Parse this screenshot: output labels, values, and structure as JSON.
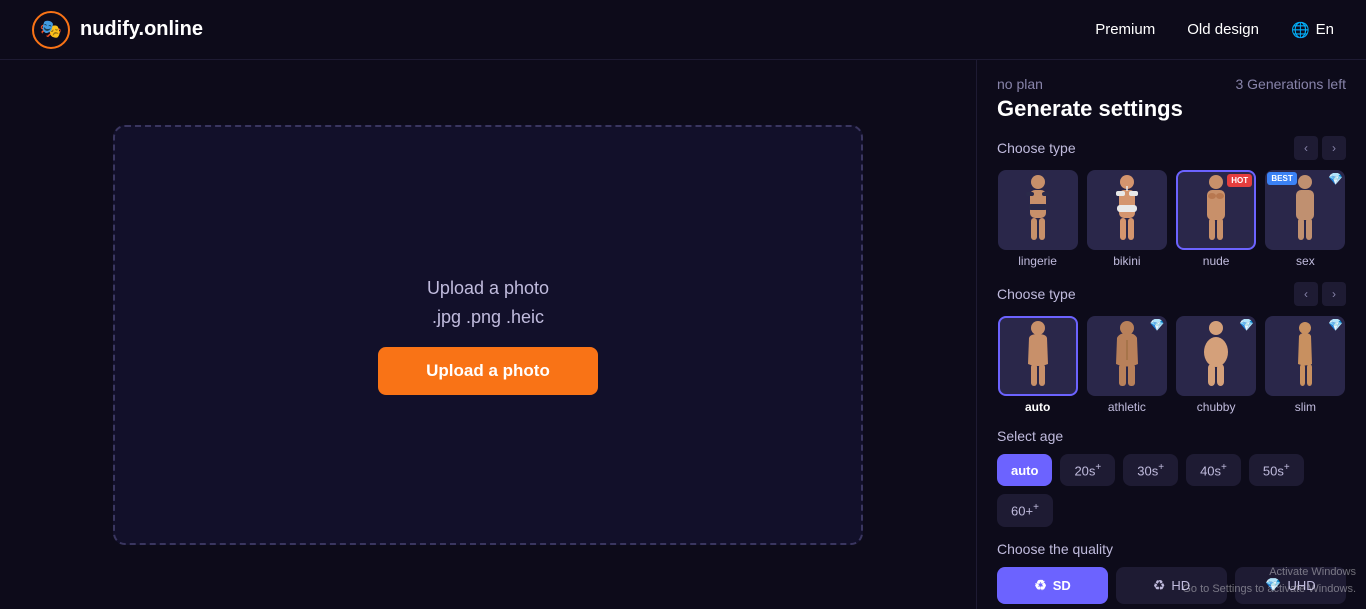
{
  "header": {
    "logo_icon": "🎭",
    "logo_text": "nudify.online",
    "nav": {
      "premium": "Premium",
      "old_design": "Old design",
      "language": "En"
    }
  },
  "upload": {
    "instruction_line1": "Upload a photo",
    "instruction_line2": ".jpg .png .heic",
    "button_label": "Upload a photo"
  },
  "settings": {
    "plan_label": "no plan",
    "generations_left": "3 Generations left",
    "title": "Generate settings",
    "choose_type_label": "Choose type",
    "type_options": [
      {
        "id": "lingerie",
        "label": "lingerie",
        "badge": null
      },
      {
        "id": "bikini",
        "label": "bikini",
        "badge": null
      },
      {
        "id": "nude",
        "label": "nude",
        "badge": "HOT"
      },
      {
        "id": "sex",
        "label": "sex",
        "badge": null
      }
    ],
    "body_type_label": "Choose type",
    "body_options": [
      {
        "id": "auto",
        "label": "auto",
        "active": true,
        "diamond": false
      },
      {
        "id": "athletic",
        "label": "athletic",
        "active": false,
        "diamond": true
      },
      {
        "id": "chubby",
        "label": "chubby",
        "active": false,
        "diamond": true
      },
      {
        "id": "slim",
        "label": "slim",
        "active": false,
        "diamond": true
      }
    ],
    "select_age_label": "Select age",
    "age_options": [
      {
        "id": "auto",
        "label": "auto",
        "active": true,
        "plus": false
      },
      {
        "id": "20s",
        "label": "20s",
        "active": false,
        "plus": true
      },
      {
        "id": "30s",
        "label": "30s",
        "active": false,
        "plus": true
      },
      {
        "id": "40s",
        "label": "40s",
        "active": false,
        "plus": true
      },
      {
        "id": "50s",
        "label": "50s",
        "active": false,
        "plus": true
      },
      {
        "id": "60plus",
        "label": "60+",
        "active": false,
        "plus": true
      }
    ],
    "quality_label": "Choose the quality",
    "quality_options": [
      {
        "id": "sd",
        "label": "SD",
        "active": true,
        "icon": "♻"
      },
      {
        "id": "hd",
        "label": "HD",
        "active": false,
        "icon": "♻"
      },
      {
        "id": "uhd",
        "label": "UHD",
        "active": false,
        "icon": null,
        "diamond": true
      }
    ]
  },
  "watermark": {
    "line1": "Activate Windows",
    "line2": "Go to Settings to activate Windows."
  }
}
